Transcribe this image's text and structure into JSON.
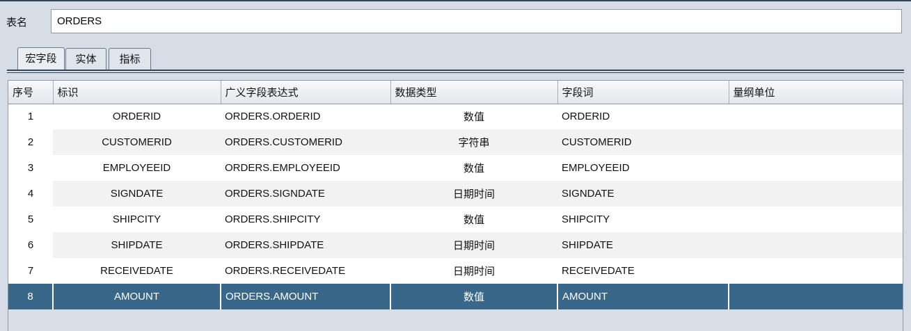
{
  "form": {
    "table_name_label": "表名",
    "table_name_value": "ORDERS"
  },
  "tabs": [
    {
      "label": "宏字段",
      "active": true
    },
    {
      "label": "实体",
      "active": false
    },
    {
      "label": "指标",
      "active": false
    }
  ],
  "table": {
    "columns": [
      "序号",
      "标识",
      "广义字段表达式",
      "数据类型",
      "字段词",
      "量纲单位"
    ],
    "rows": [
      {
        "seq": "1",
        "id": "ORDERID",
        "expr": "ORDERS.ORDERID",
        "type": "数值",
        "word": "ORDERID",
        "unit": ""
      },
      {
        "seq": "2",
        "id": "CUSTOMERID",
        "expr": "ORDERS.CUSTOMERID",
        "type": "字符串",
        "word": "CUSTOMERID",
        "unit": ""
      },
      {
        "seq": "3",
        "id": "EMPLOYEEID",
        "expr": "ORDERS.EMPLOYEEID",
        "type": "数值",
        "word": "EMPLOYEEID",
        "unit": ""
      },
      {
        "seq": "4",
        "id": "SIGNDATE",
        "expr": "ORDERS.SIGNDATE",
        "type": "日期时间",
        "word": "SIGNDATE",
        "unit": ""
      },
      {
        "seq": "5",
        "id": "SHIPCITY",
        "expr": "ORDERS.SHIPCITY",
        "type": "数值",
        "word": "SHIPCITY",
        "unit": ""
      },
      {
        "seq": "6",
        "id": "SHIPDATE",
        "expr": "ORDERS.SHIPDATE",
        "type": "日期时间",
        "word": "SHIPDATE",
        "unit": ""
      },
      {
        "seq": "7",
        "id": "RECEIVEDATE",
        "expr": "ORDERS.RECEIVEDATE",
        "type": "日期时间",
        "word": "RECEIVEDATE",
        "unit": ""
      },
      {
        "seq": "8",
        "id": "AMOUNT",
        "expr": "ORDERS.AMOUNT",
        "type": "数值",
        "word": "AMOUNT",
        "unit": "",
        "selected": true
      }
    ]
  },
  "colors": {
    "selected_row": "#39678a",
    "background": "#d6dde6"
  }
}
